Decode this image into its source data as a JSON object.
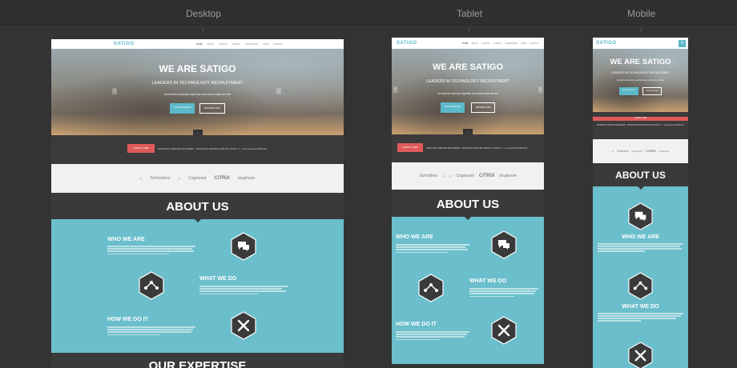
{
  "labels": {
    "desktop": "Desktop",
    "tablet": "Tablet",
    "mobile": "Mobile"
  },
  "site": {
    "logo": "SATIGO",
    "menu": [
      "HOME",
      "ABOUT",
      "CLIENTS",
      "CLIENTS",
      "CANDIDATES",
      "TEAM",
      "CONTACT"
    ],
    "hero_title": "WE ARE SATIGO",
    "hero_subtitle": "LEADERS IN TECHNOLOGY RECRUITMENT",
    "hero_tagline": "Unmatched industry expertise and world class service",
    "btn_primary": "OUR EXPERTISE",
    "btn_secondary": "BROWSE JOBS",
    "jobs_label": "LATEST JOBS",
    "jobs_text": "WINDOWS SERVER ENGINEER - WINDOWS SERVER 2008 R2 CITRIX | V - Permanent £70000.00...",
    "clients": [
      "Schroders",
      "Cognizant",
      "CiTRiX",
      "bruphone"
    ],
    "about_title": "ABOUT US",
    "who": "WHO WE ARE",
    "what": "WHAT WE DO",
    "how": "HOW WE DO IT",
    "expertise": "OUR EXPERTISE"
  },
  "colors": {
    "accent": "#5bb8c9",
    "about_bg": "#6bbecb",
    "jobs_btn": "#e05a5a",
    "dark": "#3a3a3a"
  }
}
